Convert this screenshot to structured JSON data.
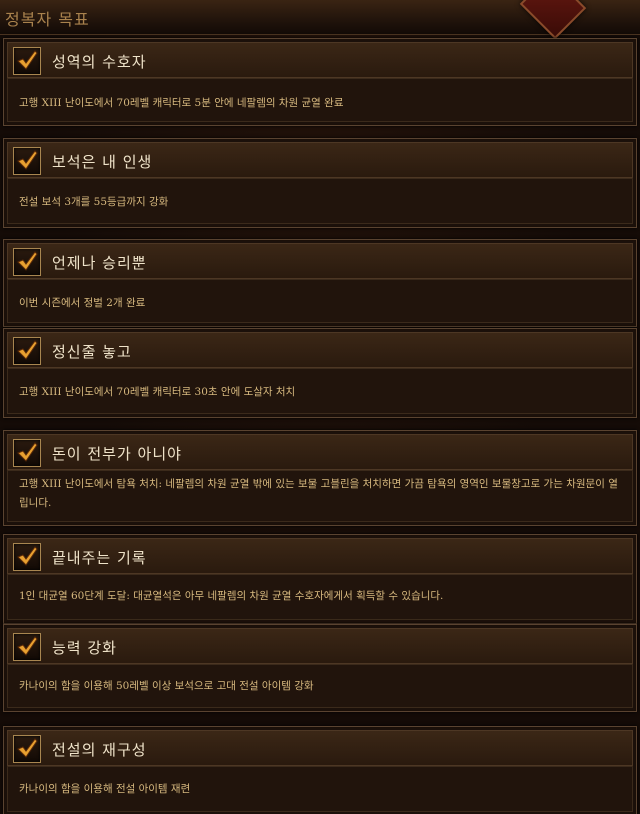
{
  "header": {
    "title": "정복자 목표"
  },
  "achievements": [
    {
      "title": "성역의 수호자",
      "description": "고행 XIII 난이도에서 70레벨 캐릭터로 5분 안에 네팔렘의 차원 균열 완료",
      "completed": true
    },
    {
      "title": "보석은 내 인생",
      "description": "전설 보석 3개를 55등급까지 강화",
      "completed": true
    },
    {
      "title": "언제나 승리뿐",
      "description": "이번 시즌에서 정벌 2개 완료",
      "completed": true
    },
    {
      "title": "정신줄 놓고",
      "description": "고행 XIII 난이도에서 70레벨 캐릭터로 30초 안에 도살자 처치",
      "completed": true
    },
    {
      "title": "돈이 전부가 아니야",
      "description": "고행 XIII 난이도에서 탐욕 처치: 네팔렘의 차원 균열 밖에 있는 보물 고블린을 처치하면 가끔 탐욕의 영역인 보물창고로 가는 차원문이 열립니다.",
      "completed": true
    },
    {
      "title": "끝내주는 기록",
      "description": "1인 대균열 60단계 도달: 대균열석은 아무 네팔렘의 차원 균열 수호자에게서 획득할 수 있습니다.",
      "completed": true
    },
    {
      "title": "능력 강화",
      "description": "카나이의 함을 이용해 50레벨 이상 보석으로 고대 전설 아이템 강화",
      "completed": true
    },
    {
      "title": "전설의 재구성",
      "description": "카나이의 함을 이용해 전설 아이템 재련",
      "completed": true
    }
  ],
  "icons": {
    "check": "checkmark-icon"
  },
  "colors": {
    "title": "#efe3c9",
    "description": "#d7b97f",
    "frame": "#5a4330",
    "check": "#e8a030"
  }
}
